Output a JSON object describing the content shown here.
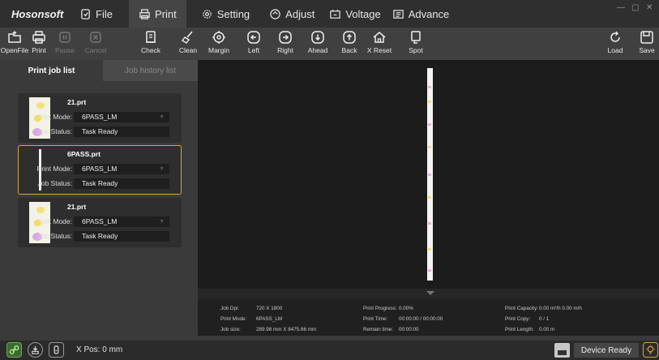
{
  "app": {
    "logo": "Hosonsoft"
  },
  "menu": {
    "file": "File",
    "print": "Print",
    "setting": "Setting",
    "adjust": "Adjust",
    "voltage": "Voltage",
    "advance": "Advance"
  },
  "toolbar": {
    "open_file": "OpenFile",
    "print": "Print",
    "pause": "Pause",
    "cancel": "Cancel",
    "check": "Check",
    "clean": "Clean",
    "margin": "Margin",
    "left": "Left",
    "right": "Right",
    "ahead": "Ahead",
    "back": "Back",
    "x_reset": "X Reset",
    "spot": "Spot",
    "load": "Load",
    "save": "Save"
  },
  "tabs": {
    "job_list": "Print job list",
    "job_history": "Job history list"
  },
  "jobs": {
    "mode_label": "Print Mode:",
    "status_label": "Job Status:",
    "items": [
      {
        "name": "21.prt",
        "mode": "6PASS_LM",
        "status": "Task Ready"
      },
      {
        "name": "6PASS.prt",
        "mode": "6PASS_LM",
        "status": "Task Ready"
      },
      {
        "name": "21.prt",
        "mode": "6PASS_LM",
        "status": "Task Ready"
      }
    ]
  },
  "info": {
    "job_dpi_label": "Job Dpi:",
    "job_dpi": "720 X 1800",
    "print_mode_label": "Print Mode:",
    "print_mode": "6PASS_LM",
    "job_size_label": "Job size:",
    "job_size": "289.98 mm  X  8475.66 mm",
    "progress_label": "Print Progress:",
    "progress": "0.00%",
    "print_time_label": "Print Time:",
    "print_time": "00:00:00 / 00:00:00",
    "remain_label": "Remain time:",
    "remain": "00:00:00",
    "capacity_label": "Print Capacity:",
    "capacity": "0.00 m²/h   0.00 m/h",
    "copy_label": "Print Copy:",
    "copy": "0 / 1",
    "length_label": "Print Length:",
    "length": "0.00 m"
  },
  "status": {
    "xpos": "X Pos: 0 mm",
    "device": "Device Ready"
  },
  "colors": {
    "accent": "#d9a443",
    "link_green": "#6ab04c"
  }
}
